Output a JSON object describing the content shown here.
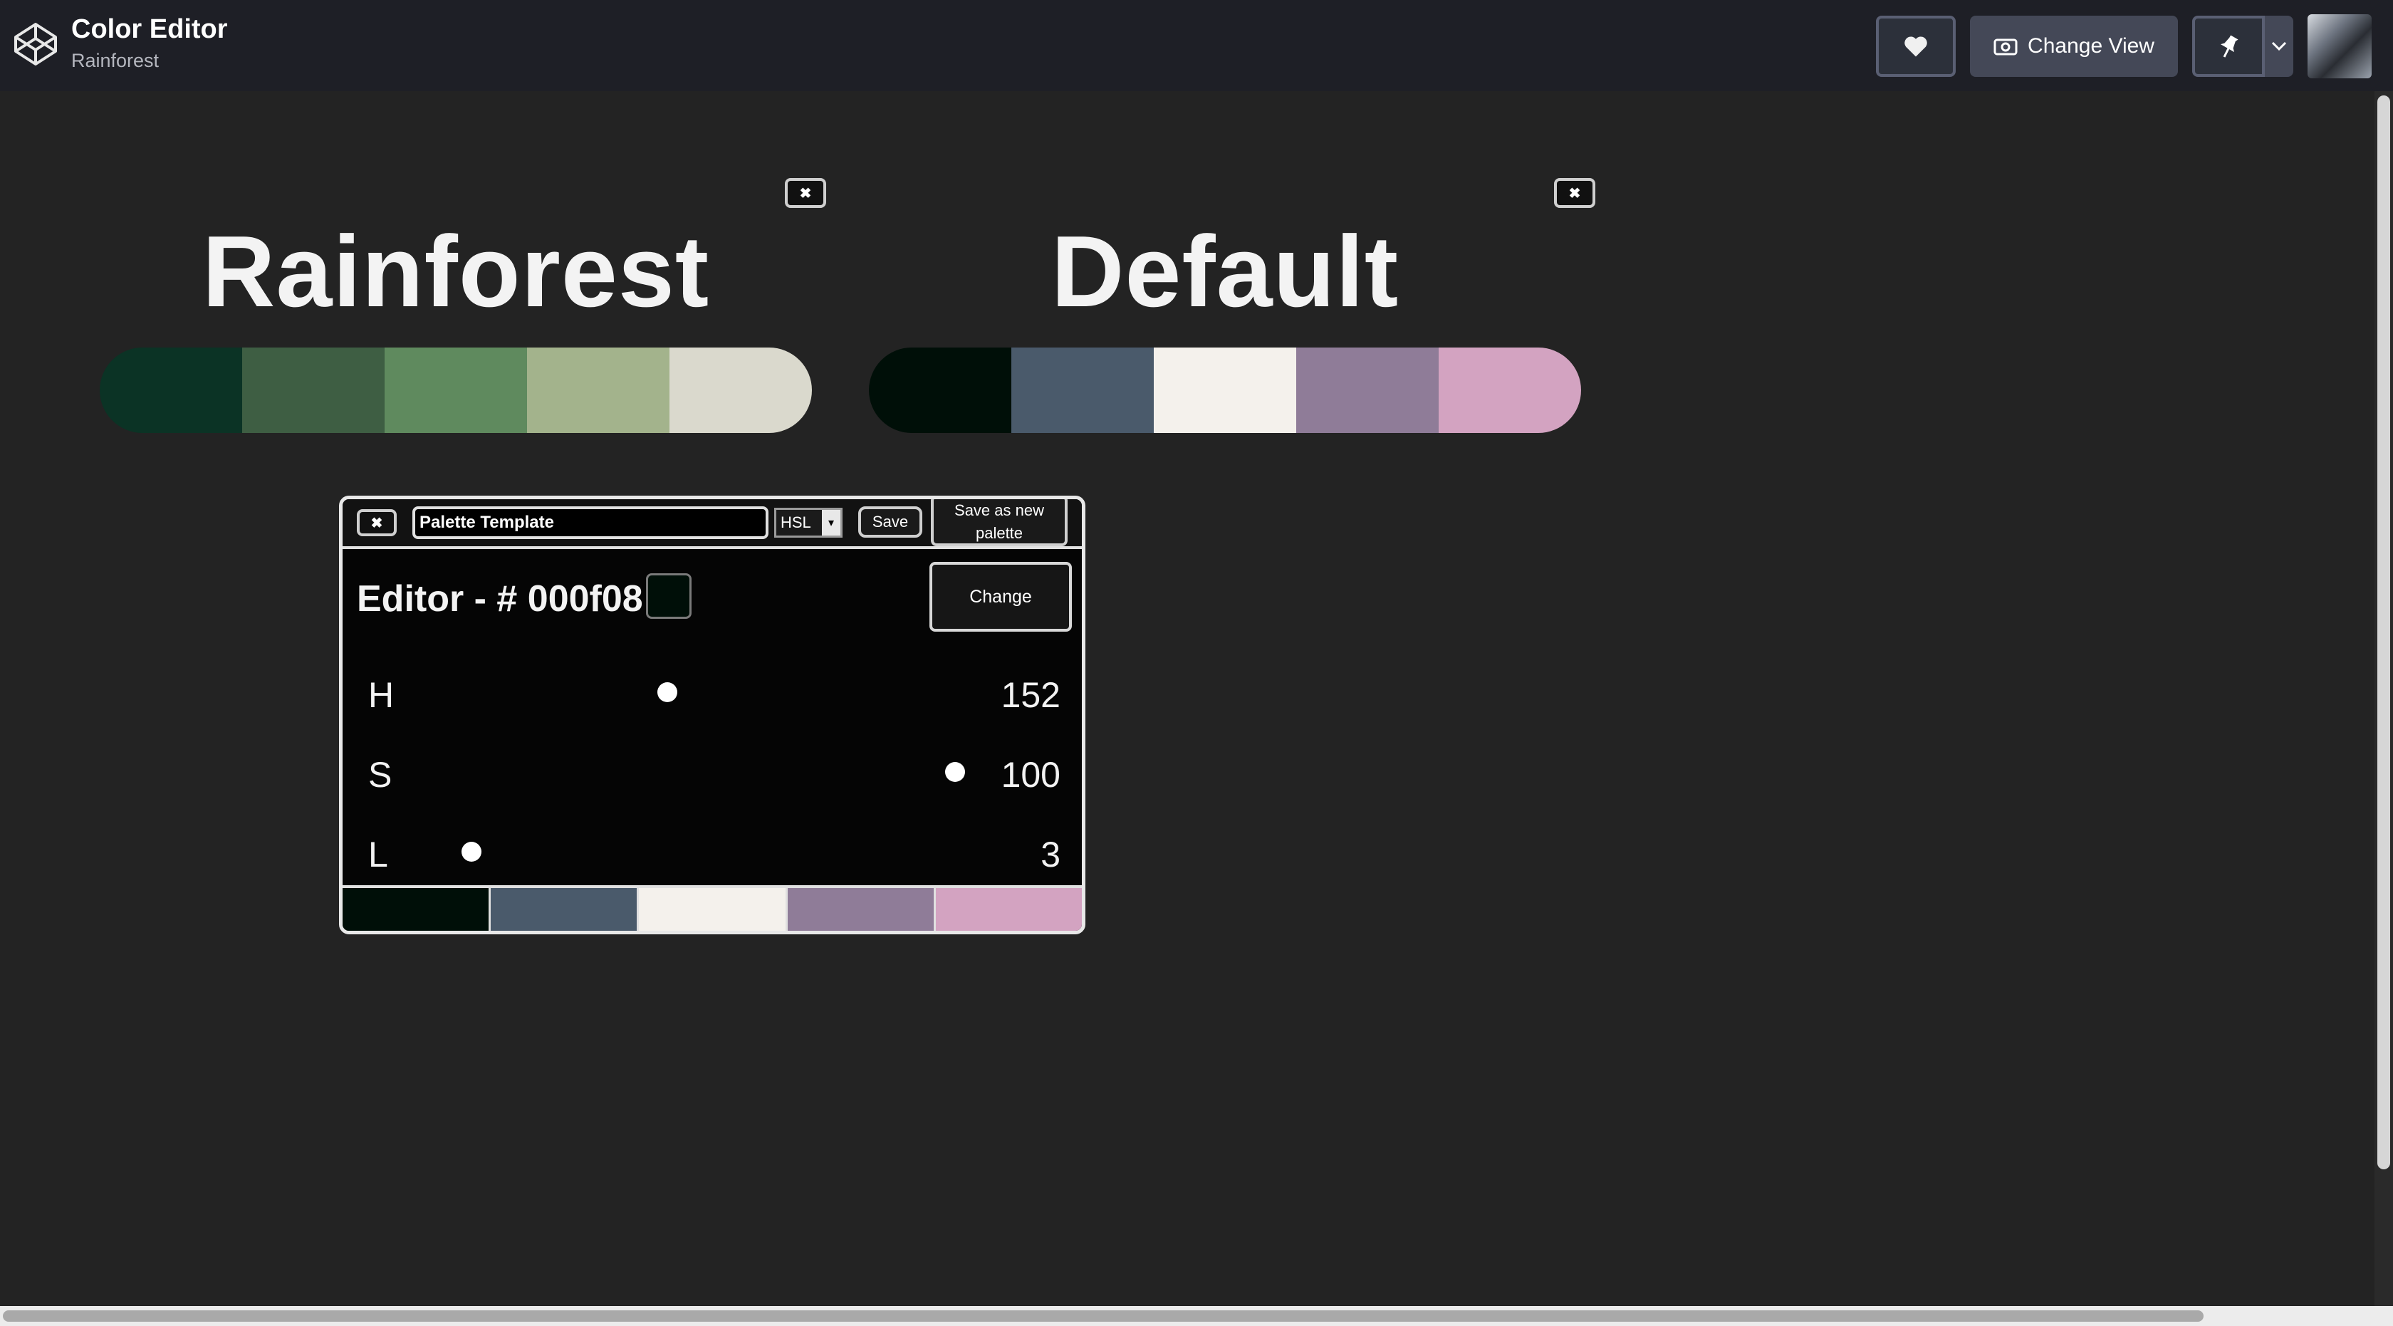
{
  "header": {
    "app_title": "Color Editor",
    "app_subtitle": "Rainforest",
    "change_view_label": "Change View",
    "logo_icon": "codepen-logo-icon",
    "heart_icon": "heart-icon",
    "pin_icon": "pin-icon",
    "caret_icon": "chevron-down-icon"
  },
  "palettes": [
    {
      "name": "Rainforest",
      "close_icon": "close-icon",
      "colors": [
        "#0b3325",
        "#3e5e43",
        "#5f8a5e",
        "#a3b38c",
        "#dad9cd"
      ]
    },
    {
      "name": "Default",
      "close_icon": "close-icon",
      "colors": [
        "#000f08",
        "#4a5a6b",
        "#f4f1ec",
        "#8f7c98",
        "#d3a3c1"
      ]
    }
  ],
  "editor": {
    "close_glyph": "✖",
    "name_value": "Palette Template",
    "mode": "HSL",
    "mode_arrow": "▾",
    "save_label": "Save",
    "save_new_label": "Save as new palette",
    "title": "Editor - # 000f08",
    "preview_color": "#000f08",
    "change_label": "Change",
    "channels": [
      {
        "label": "H",
        "value": 152,
        "max": 360
      },
      {
        "label": "S",
        "value": 100,
        "max": 100
      },
      {
        "label": "L",
        "value": 3,
        "max": 100
      }
    ],
    "swatches": [
      "#000f08",
      "#4a5a6b",
      "#f4f1ec",
      "#8f7c98",
      "#d3a3c1"
    ]
  }
}
